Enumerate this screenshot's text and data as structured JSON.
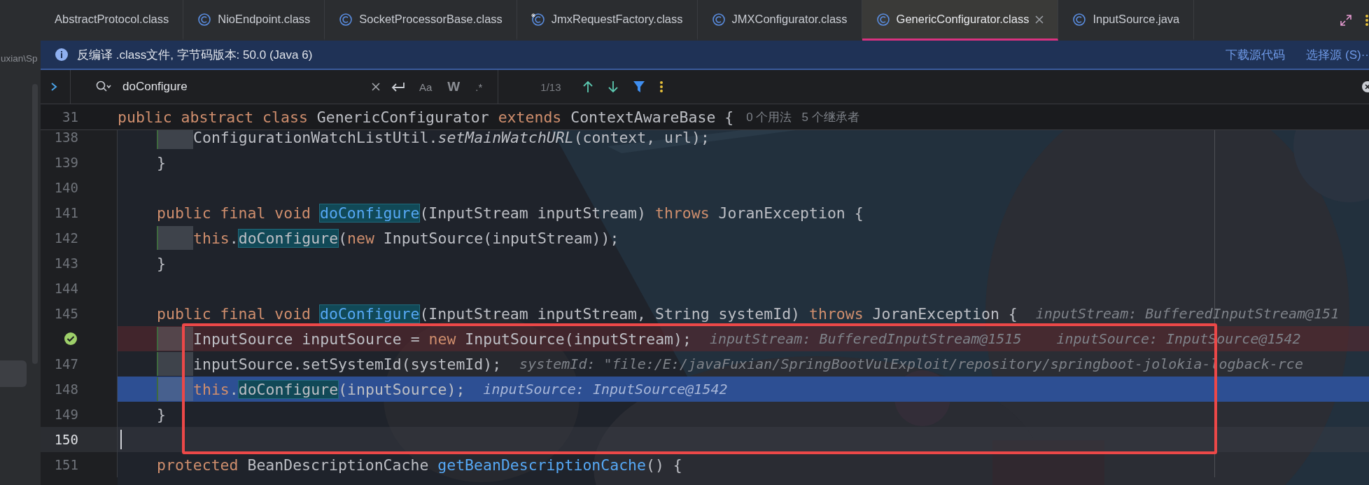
{
  "sidebar": {
    "path_fragment": "uxian\\Sp"
  },
  "tabs": [
    {
      "label": "AbstractProtocol.class",
      "kind": "plain",
      "selected": false
    },
    {
      "label": "NioEndpoint.class",
      "kind": "class",
      "selected": false
    },
    {
      "label": "SocketProcessorBase.class",
      "kind": "class",
      "selected": false
    },
    {
      "label": "JmxRequestFactory.class",
      "kind": "starred",
      "selected": false
    },
    {
      "label": "JMXConfigurator.class",
      "kind": "class",
      "selected": false
    },
    {
      "label": "GenericConfigurator.class",
      "kind": "class",
      "selected": true
    },
    {
      "label": "InputSource.java",
      "kind": "class",
      "selected": false
    }
  ],
  "info_bar": {
    "message": "反编译 .class文件, 字节码版本: 50.0 (Java 6)",
    "links": [
      "下载源代码",
      "选择源 (S)··"
    ]
  },
  "search": {
    "value": "doConfigure",
    "toggles": [
      "Aa",
      "W",
      ".*"
    ],
    "count": "1/13"
  },
  "sticky_line": {
    "number": "31",
    "segments": [
      {
        "kind": "keyword",
        "text": "public abstract class "
      },
      {
        "kind": "plain",
        "text": "GenericConfigurator "
      },
      {
        "kind": "keyword",
        "text": "extends "
      },
      {
        "kind": "plain",
        "text": "ContextAwareBase {"
      }
    ],
    "hints": [
      "0 个用法",
      "5 个继承者"
    ]
  },
  "lines": [
    {
      "number": "138",
      "kind": "statement",
      "breakpoint": false,
      "executing": false,
      "current": false,
      "segments": [
        {
          "kind": "plain",
          "text": "ConfigurationWatchListUtil."
        },
        {
          "kind": "static",
          "text": "setMainWatchURL"
        },
        {
          "kind": "plain",
          "text": "(context, url);"
        }
      ]
    },
    {
      "number": "139",
      "kind": "member",
      "breakpoint": false,
      "executing": false,
      "current": false,
      "segments": [
        {
          "kind": "plain",
          "text": "}"
        }
      ]
    },
    {
      "number": "140",
      "kind": "blank",
      "breakpoint": false,
      "executing": false,
      "current": false
    },
    {
      "number": "141",
      "kind": "member",
      "breakpoint": false,
      "executing": false,
      "current": false,
      "segments": [
        {
          "kind": "keyword",
          "text": "public final void "
        },
        {
          "kind": "method-match",
          "text": "doConfigure"
        },
        {
          "kind": "plain",
          "text": "(InputStream inputStream) "
        },
        {
          "kind": "keyword",
          "text": "throws "
        },
        {
          "kind": "plain",
          "text": "JoranException {"
        }
      ]
    },
    {
      "number": "142",
      "kind": "statement",
      "breakpoint": false,
      "executing": false,
      "current": false,
      "segments": [
        {
          "kind": "keyword",
          "text": "this"
        },
        {
          "kind": "plain",
          "text": "."
        },
        {
          "kind": "match",
          "text": "doConfigure"
        },
        {
          "kind": "plain",
          "text": "("
        },
        {
          "kind": "keyword",
          "text": "new "
        },
        {
          "kind": "plain",
          "text": "InputSource(inputStream));"
        }
      ]
    },
    {
      "number": "143",
      "kind": "member",
      "breakpoint": false,
      "executing": false,
      "current": false,
      "segments": [
        {
          "kind": "plain",
          "text": "}"
        }
      ]
    },
    {
      "number": "144",
      "kind": "blank",
      "breakpoint": false,
      "executing": false,
      "current": false
    },
    {
      "number": "145",
      "kind": "member",
      "breakpoint": false,
      "executing": false,
      "current": false,
      "segments": [
        {
          "kind": "keyword",
          "text": "public final void "
        },
        {
          "kind": "method-match",
          "text": "doConfigure"
        },
        {
          "kind": "plain",
          "text": "(InputStream inputStream, String systemId) "
        },
        {
          "kind": "keyword",
          "text": "throws "
        },
        {
          "kind": "plain",
          "text": "JoranException {"
        }
      ],
      "hints": [
        "inputStream: BufferedInputStream@151"
      ]
    },
    {
      "kind": "statement",
      "breakpoint": true,
      "executing": false,
      "current": false,
      "segments": [
        {
          "kind": "plain",
          "text": "InputSource inputSource = "
        },
        {
          "kind": "keyword",
          "text": "new "
        },
        {
          "kind": "plain",
          "text": "InputSource(inputStream);"
        }
      ],
      "hints": [
        "inputStream: BufferedInputStream@1515",
        "inputSource: InputSource@1542"
      ]
    },
    {
      "number": "147",
      "kind": "statement",
      "breakpoint": false,
      "executing": false,
      "current": false,
      "segments": [
        {
          "kind": "plain",
          "text": "inputSource.setSystemId(systemId);"
        }
      ],
      "hints": [
        "systemId: \"file:/E:/javaFuxian/SpringBootVulExploit/repository/springboot-jolokia-logback-rce"
      ]
    },
    {
      "number": "148",
      "kind": "statement",
      "breakpoint": false,
      "executing": true,
      "current": false,
      "segments": [
        {
          "kind": "keyword",
          "text": "this"
        },
        {
          "kind": "plain",
          "text": "."
        },
        {
          "kind": "match",
          "text": "doConfigure"
        },
        {
          "kind": "plain",
          "text": "(inputSource);"
        }
      ],
      "hints": [
        "inputSource: InputSource@1542"
      ]
    },
    {
      "number": "149",
      "kind": "member",
      "breakpoint": false,
      "executing": false,
      "current": false,
      "segments": [
        {
          "kind": "plain",
          "text": "}"
        }
      ]
    },
    {
      "number": "150",
      "kind": "blank",
      "breakpoint": false,
      "executing": false,
      "current": true
    },
    {
      "number": "151",
      "kind": "member",
      "breakpoint": false,
      "executing": false,
      "current": false,
      "segments": [
        {
          "kind": "keyword",
          "text": "protected "
        },
        {
          "kind": "plain",
          "text": "BeanDescriptionCache "
        },
        {
          "kind": "method",
          "text": "getBeanDescriptionCache"
        },
        {
          "kind": "plain",
          "text": "() {"
        }
      ]
    }
  ]
}
